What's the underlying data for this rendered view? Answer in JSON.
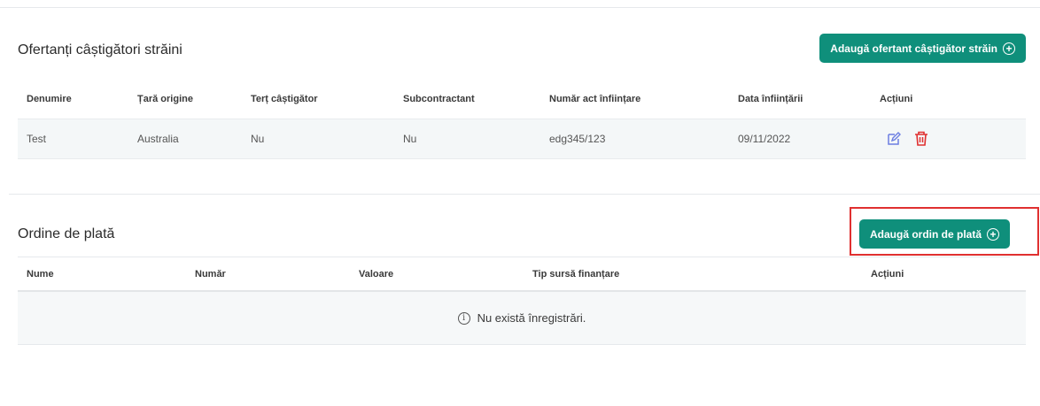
{
  "foreign_winners": {
    "title": "Ofertanți câștigători străini",
    "add_button_label": "Adaugă ofertant câștigător străin",
    "columns": [
      "Denumire",
      "Țară origine",
      "Terț câștigător",
      "Subcontractant",
      "Număr act înființare",
      "Data înființării",
      "Acțiuni"
    ],
    "rows": [
      {
        "name": "Test",
        "country": "Australia",
        "third_party": "Nu",
        "subcontractor": "Nu",
        "registration_no": "edg345/123",
        "registration_date": "09/11/2022"
      }
    ],
    "action_icons": [
      "edit-icon",
      "delete-icon"
    ],
    "accent_color": "#0f8f7b",
    "edit_color": "#6c7ee1",
    "delete_color": "#e03030"
  },
  "payment_orders": {
    "title": "Ordine de plată",
    "add_button_label": "Adaugă ordin de plată",
    "columns": [
      "Nume",
      "Număr",
      "Valoare",
      "Tip sursă finanțare",
      "Acțiuni"
    ],
    "empty_message": "Nu există înregistrări.",
    "highlight_color": "#e03030"
  }
}
